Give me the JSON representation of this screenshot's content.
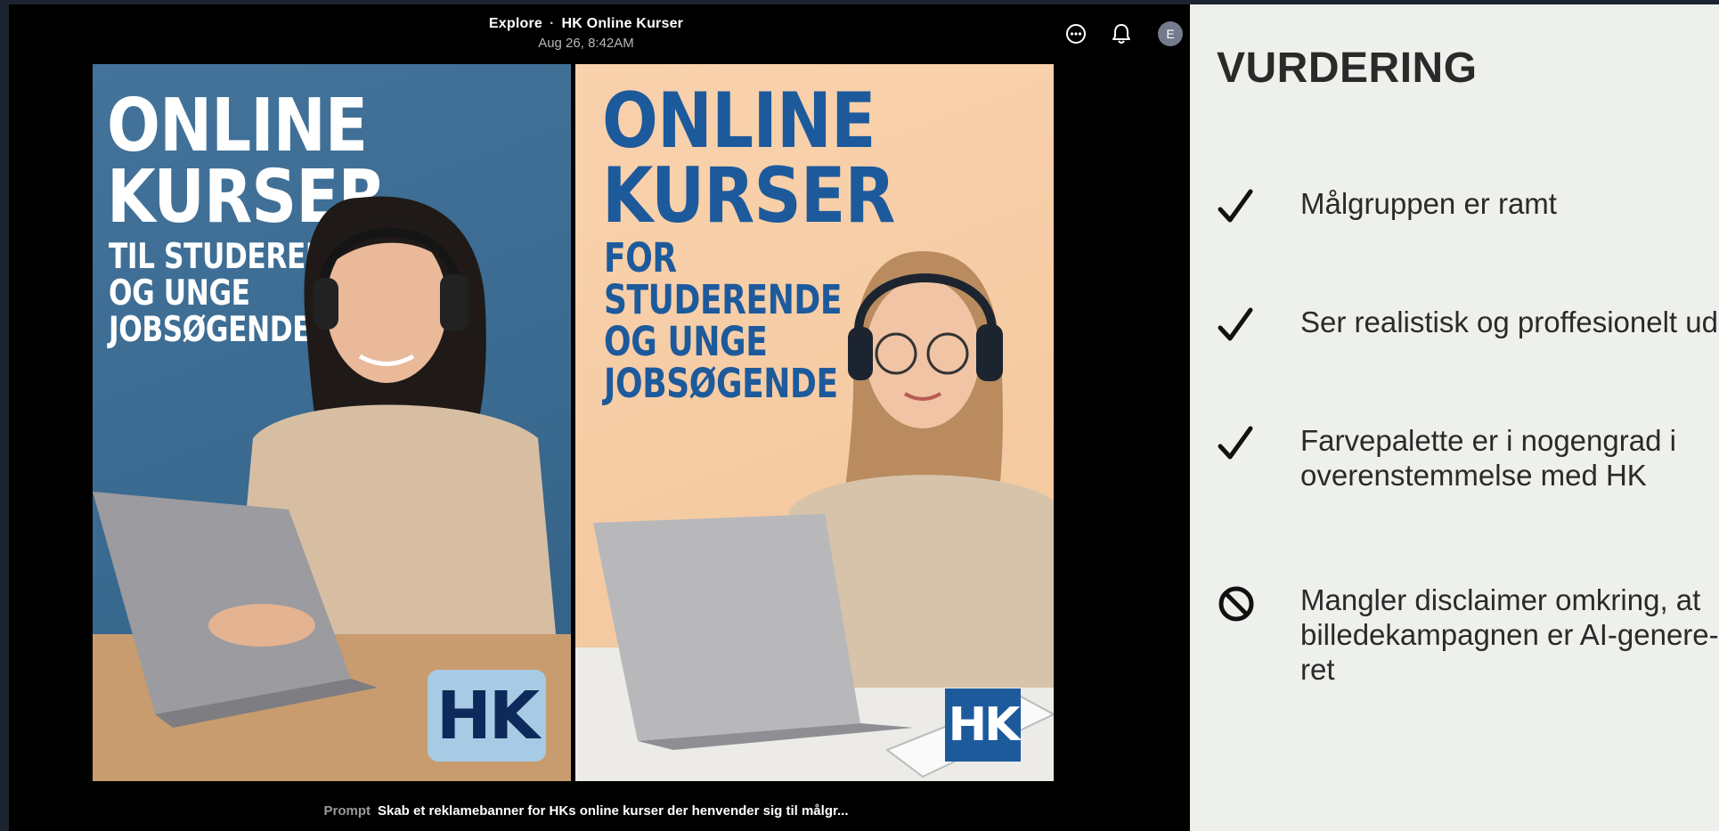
{
  "header": {
    "breadcrumb_root": "Explore",
    "breadcrumb_separator": "·",
    "breadcrumb_title": "HK Online Kurser",
    "date": "Aug 26, 8:42AM",
    "avatar_initial": "E"
  },
  "icons": [
    "more-icon",
    "bell-icon",
    "avatar"
  ],
  "images": {
    "left": {
      "headline_1": "ONLINE",
      "headline_2": "KURSER",
      "sub_1": "TIL STUDERENDE",
      "sub_2": "OG UNGE",
      "sub_3": "JOBSØGENDE",
      "logo": "HK",
      "bg_color": "#3f6f96",
      "text_color": "#ffffff",
      "logo_bg": "#a7cbe4",
      "logo_color": "#0d2a5a"
    },
    "right": {
      "headline_1": "ONLINE",
      "headline_2": "KURSER",
      "sub_1": "FOR",
      "sub_2": "STUDERENDE",
      "sub_3": "OG UNGE",
      "sub_4": "JOBSØGENDE",
      "logo": "HK",
      "bg_color": "#f6cda4",
      "text_color": "#1d5a9c",
      "logo_bg": "#1d5a9c",
      "logo_color": "#ffffff"
    }
  },
  "prompt": {
    "label": "Prompt",
    "text": "Skab et reklamebanner for HKs online kurser der henvender sig til målgr..."
  },
  "rating": {
    "title": "VURDERING",
    "items": [
      {
        "mark": "check-icon",
        "text": "Målgruppen er ramt"
      },
      {
        "mark": "check-icon",
        "text": "Ser realistisk og proffesionelt ud"
      },
      {
        "mark": "check-icon",
        "text": "Farvepalette  er i nogengrad i overenstemmelse med HK"
      },
      {
        "mark": "prohibited-icon",
        "text": "Mangler disclaimer omkring, at billedekampagnen er AI-genere-ret"
      }
    ]
  }
}
